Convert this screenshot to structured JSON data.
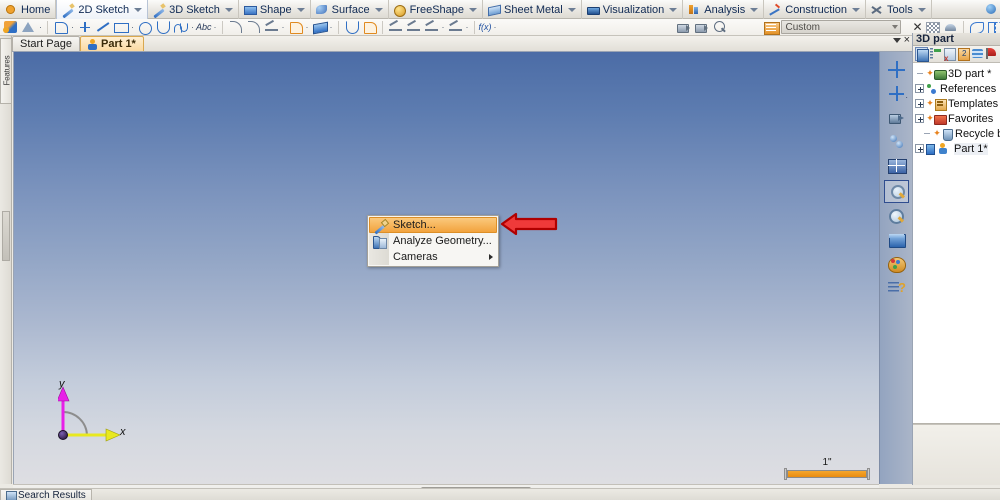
{
  "ribbon": {
    "tabs": [
      {
        "label": "Home",
        "icon": "home-icon",
        "caret": false,
        "active": false
      },
      {
        "label": "2D Sketch",
        "icon": "pen-icon",
        "caret": true,
        "active": true
      },
      {
        "label": "3D Sketch",
        "icon": "pen-icon",
        "caret": true,
        "active": false
      },
      {
        "label": "Shape",
        "icon": "shape-icon",
        "caret": true,
        "active": false
      },
      {
        "label": "Surface",
        "icon": "surface-icon",
        "caret": true,
        "active": false
      },
      {
        "label": "FreeShape",
        "icon": "freeshape-icon",
        "caret": true,
        "active": false
      },
      {
        "label": "Sheet Metal",
        "icon": "sheet-metal-icon",
        "caret": true,
        "active": false
      },
      {
        "label": "Visualization",
        "icon": "visualization-icon",
        "caret": true,
        "active": false
      },
      {
        "label": "Analysis",
        "icon": "analysis-icon",
        "caret": true,
        "active": false
      },
      {
        "label": "Construction",
        "icon": "construction-icon",
        "caret": true,
        "active": false
      },
      {
        "label": "Tools",
        "icon": "tools-icon",
        "caret": true,
        "active": false
      }
    ],
    "tools": {
      "text_tool_label": "Abc",
      "fx_tool_label": "f(x)",
      "combo_value": "Custom"
    }
  },
  "document_tabs": [
    {
      "label": "Start Page",
      "active": false
    },
    {
      "label": "Part 1*",
      "active": true
    }
  ],
  "left_dock": {
    "vertical_tab_label": "Features"
  },
  "viewport": {
    "axis_x_label": "x",
    "axis_y_label": "y",
    "scale_bar_label": "1\""
  },
  "context_menu": {
    "items": [
      {
        "label": "Sketch...",
        "icon": "pencil-icon",
        "highlighted": true,
        "submenu": false
      },
      {
        "label": "Analyze Geometry...",
        "icon": "geometry-icon",
        "highlighted": false,
        "submenu": false
      },
      {
        "label": "Cameras",
        "icon": "",
        "highlighted": false,
        "submenu": true
      }
    ]
  },
  "view_toolbar": [
    {
      "name": "pan-move-icon",
      "selected": false,
      "has_dropdown": false
    },
    {
      "name": "rotate-axis-icon",
      "selected": false,
      "has_dropdown": true
    },
    {
      "name": "camera-icon",
      "selected": false,
      "has_dropdown": false
    },
    {
      "name": "pivot-icon",
      "selected": false,
      "has_dropdown": false
    },
    {
      "name": "grid-view-icon",
      "selected": false,
      "has_dropdown": true
    },
    {
      "name": "zoom-window-icon",
      "selected": true,
      "has_dropdown": false
    },
    {
      "name": "zoom-icon",
      "selected": false,
      "has_dropdown": false
    },
    {
      "name": "view-cube-icon",
      "selected": false,
      "has_dropdown": false
    },
    {
      "name": "palette-icon",
      "selected": false,
      "has_dropdown": false
    },
    {
      "name": "help-icon",
      "selected": false,
      "has_dropdown": false
    }
  ],
  "tree_panel": {
    "title": "3D part",
    "toolbar_icons": [
      "select-mode-icon",
      "expand-tree-icon",
      "delete-node-icon",
      "numbering-icon",
      "layers-icon",
      "flag-icon"
    ],
    "nodes": [
      {
        "label": "3D part *",
        "icon": "part-icon",
        "expander": "none",
        "star": true,
        "indent": 0
      },
      {
        "label": "References",
        "icon": "references-icon",
        "expander": "plus",
        "star": false,
        "indent": 0
      },
      {
        "label": "Templates",
        "icon": "templates-icon",
        "expander": "plus",
        "star": true,
        "indent": 0
      },
      {
        "label": "Favorites",
        "icon": "favorites-icon",
        "expander": "plus",
        "star": true,
        "indent": 0
      },
      {
        "label": "Recycle bin",
        "icon": "recycle-bin-icon",
        "expander": "none",
        "star": true,
        "indent": 1
      },
      {
        "label": "Part 1*",
        "icon": "part1-icon",
        "expander": "plus",
        "star": false,
        "indent": 0
      }
    ]
  },
  "status_bar": {
    "tab_label": "Search Results"
  },
  "colors": {
    "accent_orange": "#f0a33e",
    "highlight_menu": "#f2a33e",
    "viewport_top": "#4b6ca6",
    "viewport_bottom": "#dedee2",
    "callout_red": "#d81f1f",
    "axis_y": "#e81fe8",
    "axis_x": "#e8e81f"
  }
}
